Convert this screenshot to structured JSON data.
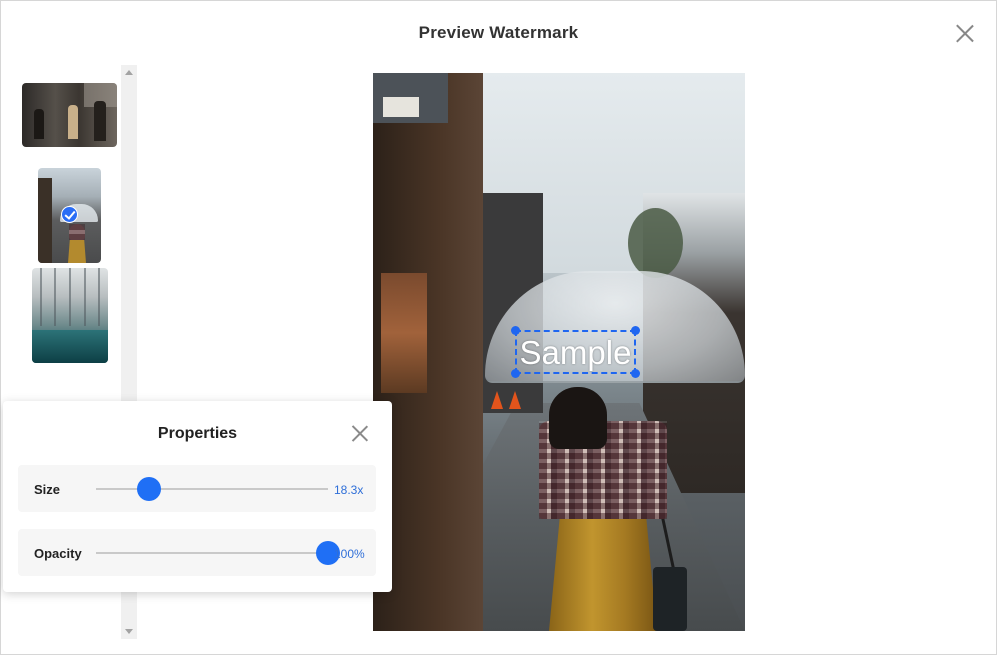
{
  "dialog": {
    "title": "Preview Watermark",
    "close_icon": "close-icon"
  },
  "thumbnails": [
    {
      "name": "crowd-photo",
      "selected": false
    },
    {
      "name": "umbrella-street-photo",
      "selected": true
    },
    {
      "name": "glass-roof-pool-photo",
      "selected": false
    }
  ],
  "watermark": {
    "text": "Sample",
    "color": "#ffffff",
    "selection_color": "#1f66f0"
  },
  "properties": {
    "title": "Properties",
    "size": {
      "label": "Size",
      "value_text": "18.3x",
      "level": 0.23
    },
    "opacity": {
      "label": "Opacity",
      "value_text": "100%",
      "level": 1.0
    }
  },
  "colors": {
    "accent": "#1f6ff5",
    "value_text": "#2f6fd8"
  }
}
